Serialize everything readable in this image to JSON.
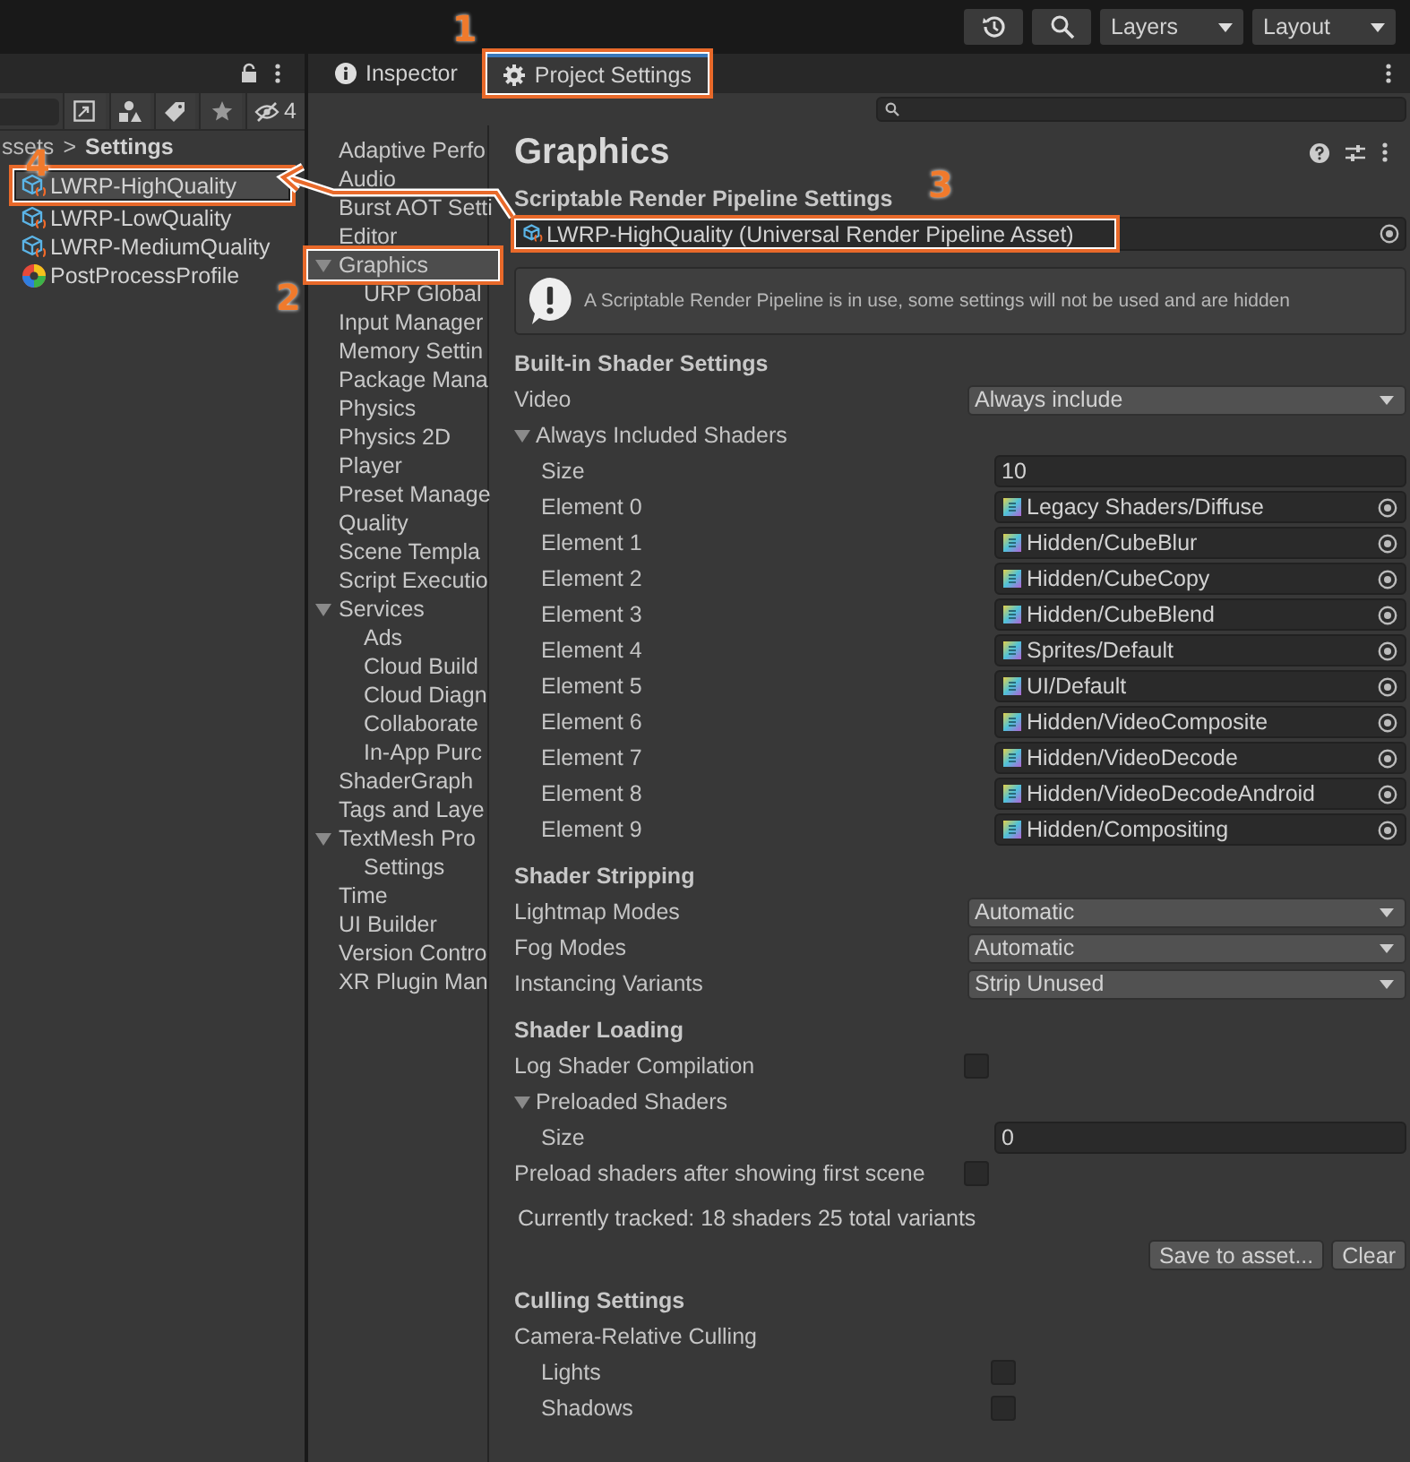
{
  "toolbar": {
    "dropdowns": [
      "Layers",
      "Layout"
    ]
  },
  "project": {
    "hidden_count": "4",
    "breadcrumb": [
      "ssets",
      "Settings"
    ],
    "breadcrumb_separator": ">",
    "assets": [
      {
        "name": "LWRP-HighQuality",
        "kind": "pipeline",
        "selected": true,
        "annotation": "4"
      },
      {
        "name": "LWRP-LowQuality",
        "kind": "pipeline",
        "selected": false
      },
      {
        "name": "LWRP-MediumQuality",
        "kind": "pipeline",
        "selected": false
      },
      {
        "name": "PostProcessProfile",
        "kind": "profile",
        "selected": false
      }
    ]
  },
  "tabs": [
    {
      "label": "Inspector",
      "kind": "info",
      "selected": false
    },
    {
      "label": "Project Settings",
      "kind": "gear",
      "selected": true,
      "annotation": "1"
    }
  ],
  "nav": [
    {
      "label": "Adaptive Perfo",
      "selected": false
    },
    {
      "label": "Audio",
      "selected": false
    },
    {
      "label": "Burst AOT Setti",
      "selected": false
    },
    {
      "label": "Editor",
      "selected": false
    },
    {
      "label": "Graphics",
      "selected": true,
      "expanded": true,
      "annotation": "2",
      "children": [
        {
          "label": "URP Global",
          "selected": false
        }
      ]
    },
    {
      "label": "Input Manager",
      "selected": false
    },
    {
      "label": "Memory Settin",
      "selected": false
    },
    {
      "label": "Package Mana",
      "selected": false
    },
    {
      "label": "Physics",
      "selected": false
    },
    {
      "label": "Physics 2D",
      "selected": false
    },
    {
      "label": "Player",
      "selected": false
    },
    {
      "label": "Preset Manage",
      "selected": false
    },
    {
      "label": "Quality",
      "selected": false
    },
    {
      "label": "Scene Templa",
      "selected": false
    },
    {
      "label": "Script Executio",
      "selected": false
    },
    {
      "label": "Services",
      "selected": false,
      "expanded": true,
      "children": [
        {
          "label": "Ads",
          "selected": false
        },
        {
          "label": "Cloud Build",
          "selected": false
        },
        {
          "label": "Cloud Diagn",
          "selected": false
        },
        {
          "label": "Collaborate",
          "selected": false
        },
        {
          "label": "In-App Purc",
          "selected": false
        }
      ]
    },
    {
      "label": "ShaderGraph",
      "selected": false
    },
    {
      "label": "Tags and Laye",
      "selected": false
    },
    {
      "label": "TextMesh Pro",
      "selected": false,
      "expanded": true,
      "children": [
        {
          "label": "Settings",
          "selected": false
        }
      ]
    },
    {
      "label": "Time",
      "selected": false
    },
    {
      "label": "UI Builder",
      "selected": false
    },
    {
      "label": "Version Contro",
      "selected": false
    },
    {
      "label": "XR Plugin Man",
      "selected": false
    }
  ],
  "page": {
    "title": "Graphics",
    "srp_label": "Scriptable Render Pipeline Settings",
    "srp_value": "LWRP-HighQuality (Universal Render Pipeline Asset)",
    "srp_annotation": "3",
    "help": "A Scriptable Render Pipeline is in use, some settings will not be used and are hidden",
    "sections": [
      {
        "title": "Built-in Shader Settings",
        "rows": [
          {
            "kind": "dropdown",
            "label": "Video",
            "value": "Always include"
          },
          {
            "kind": "foldout",
            "label": "Always Included Shaders",
            "expanded": true,
            "children": [
              {
                "kind": "text",
                "label": "Size",
                "value": "10"
              },
              {
                "kind": "object",
                "label": "Element 0",
                "value": "Legacy Shaders/Diffuse"
              },
              {
                "kind": "object",
                "label": "Element 1",
                "value": "Hidden/CubeBlur"
              },
              {
                "kind": "object",
                "label": "Element 2",
                "value": "Hidden/CubeCopy"
              },
              {
                "kind": "object",
                "label": "Element 3",
                "value": "Hidden/CubeBlend"
              },
              {
                "kind": "object",
                "label": "Element 4",
                "value": "Sprites/Default"
              },
              {
                "kind": "object",
                "label": "Element 5",
                "value": "UI/Default"
              },
              {
                "kind": "object",
                "label": "Element 6",
                "value": "Hidden/VideoComposite"
              },
              {
                "kind": "object",
                "label": "Element 7",
                "value": "Hidden/VideoDecode"
              },
              {
                "kind": "object",
                "label": "Element 8",
                "value": "Hidden/VideoDecodeAndroid"
              },
              {
                "kind": "object",
                "label": "Element 9",
                "value": "Hidden/Compositing"
              }
            ]
          }
        ]
      },
      {
        "title": "Shader Stripping",
        "rows": [
          {
            "kind": "dropdown",
            "label": "Lightmap Modes",
            "value": "Automatic"
          },
          {
            "kind": "dropdown",
            "label": "Fog Modes",
            "value": "Automatic"
          },
          {
            "kind": "dropdown",
            "label": "Instancing Variants",
            "value": "Strip Unused"
          }
        ]
      },
      {
        "title": "Shader Loading",
        "rows": [
          {
            "kind": "checkbox",
            "label": "Log Shader Compilation",
            "checked": false
          },
          {
            "kind": "foldout",
            "label": "Preloaded Shaders",
            "expanded": true,
            "children": [
              {
                "kind": "text",
                "label": "Size",
                "value": "0"
              }
            ]
          },
          {
            "kind": "checkbox",
            "label": "Preload shaders after showing first scene",
            "checked": false
          },
          {
            "kind": "note",
            "label": "Currently tracked: 18 shaders 25 total variants"
          },
          {
            "kind": "buttons",
            "buttons": [
              "Save to asset...",
              "Clear"
            ]
          }
        ]
      },
      {
        "title": "Culling Settings",
        "rows": [
          {
            "kind": "group",
            "label": "Camera-Relative Culling",
            "children": [
              {
                "kind": "checkbox",
                "label": "Lights",
                "checked": false
              },
              {
                "kind": "checkbox",
                "label": "Shadows",
                "checked": false
              }
            ]
          }
        ]
      }
    ]
  }
}
